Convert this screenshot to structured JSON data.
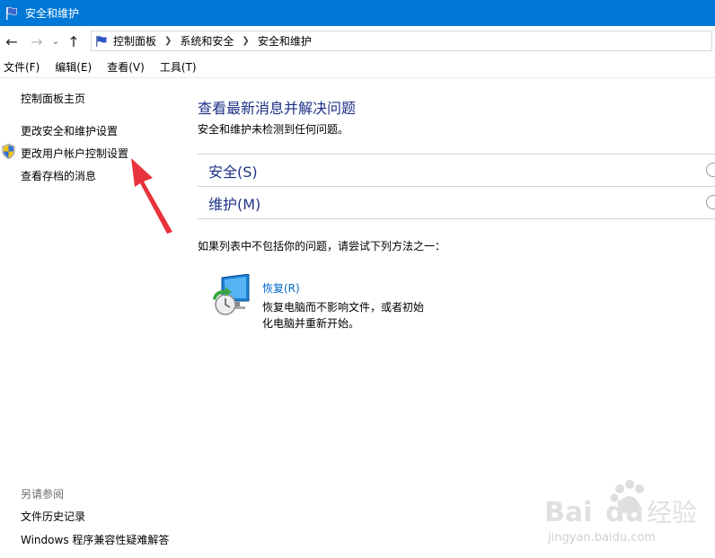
{
  "window": {
    "title": "安全和维护"
  },
  "nav": {
    "back": "back-arrow",
    "forward": "forward-arrow",
    "recent": "chevron-down",
    "up": "up-arrow",
    "breadcrumb": [
      "控制面板",
      "系统和安全",
      "安全和维护"
    ]
  },
  "menu": [
    "文件(F)",
    "编辑(E)",
    "查看(V)",
    "工具(T)"
  ],
  "left": {
    "home": "控制面板主页",
    "change_settings": "更改安全和维护设置",
    "uac": "更改用户帐户控制设置",
    "archived": "查看存档的消息",
    "see_also": "另请参阅",
    "file_history": "文件历史记录",
    "compat": "Windows 程序兼容性疑难解答"
  },
  "main": {
    "title": "查看最新消息并解决问题",
    "subtitle": "安全和维护未检测到任何问题。",
    "sections": [
      "安全(S)",
      "维护(M)"
    ],
    "hint": "如果列表中不包括你的问题，请尝试下列方法之一：",
    "recovery": {
      "link": "恢复(R)",
      "desc_line1": "恢复电脑而不影响文件，或者初始",
      "desc_line2": "化电脑并重新开始。"
    }
  },
  "watermark": {
    "brand": "Bai",
    "brand2": "du",
    "cn": "经验",
    "url": "jingyan.baidu.com"
  },
  "colors": {
    "titlebar": "#0078d7",
    "heading": "#1e3287",
    "link": "#0066cc",
    "annotation": "#e8323c"
  }
}
